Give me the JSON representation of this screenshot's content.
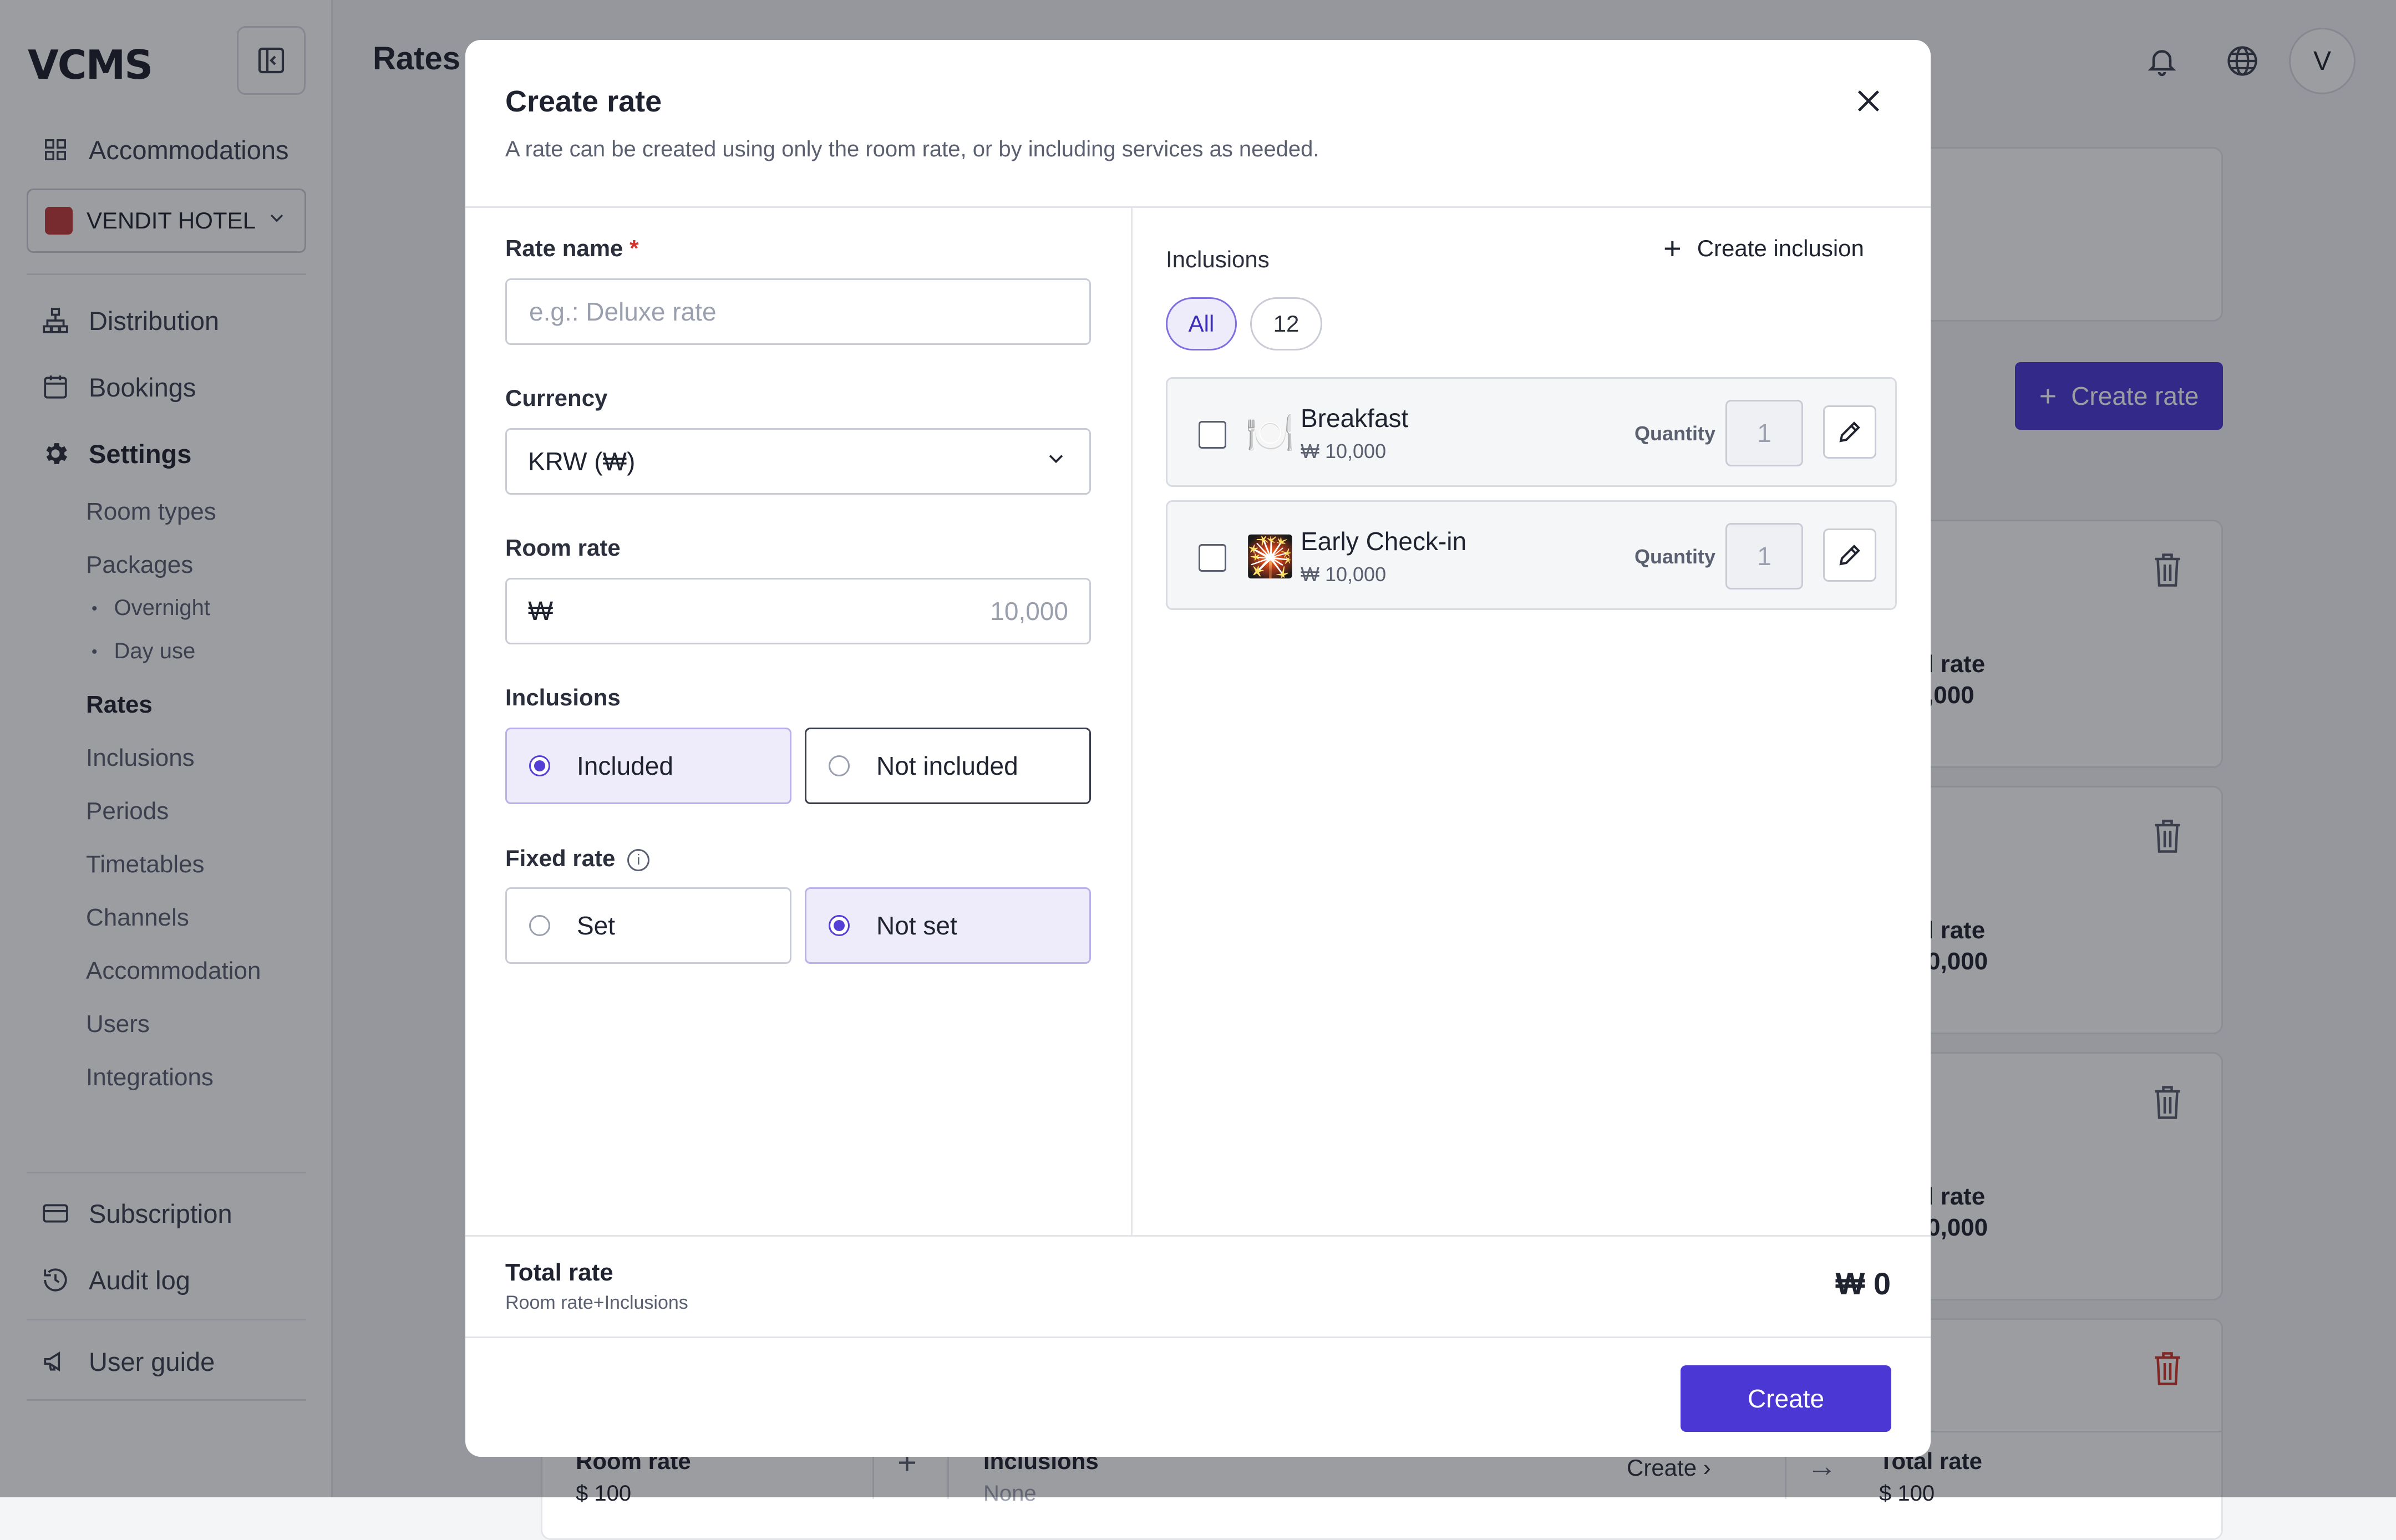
{
  "app": {
    "logo": "VCMS"
  },
  "sidebar": {
    "accommodations": "Accommodations",
    "hotel": "VENDIT HOTEL",
    "distribution": "Distribution",
    "bookings": "Bookings",
    "settings": "Settings",
    "settings_items": [
      "Room types",
      "Packages",
      "Rates",
      "Inclusions",
      "Periods",
      "Timetables",
      "Channels",
      "Accommodation",
      "Users",
      "Integrations"
    ],
    "packages_sub": [
      "Overnight",
      "Day use"
    ],
    "subscription": "Subscription",
    "audit_log": "Audit log",
    "user_guide": "User guide"
  },
  "header": {
    "title": "Rates",
    "avatar": "V"
  },
  "background": {
    "create_rate": "Create rate",
    "totals": [
      {
        "label": "l rate",
        "value": ",000"
      },
      {
        "label": "l rate",
        "value": "0,000"
      },
      {
        "label": "l rate",
        "value": "0,000"
      }
    ],
    "bottom": {
      "room_rate_label": "Room rate",
      "room_rate_value": "$ 100",
      "inclusions_label": "Inclusions",
      "inclusions_value": "None",
      "create_link": "Create",
      "total_label": "Total rate",
      "total_value": "$ 100"
    },
    "colors": {
      "accent": "#4a37d4",
      "danger": "#d0342c"
    }
  },
  "modal": {
    "title": "Create rate",
    "description": "A rate can be created using only the room rate, or by including services as needed.",
    "rate_name": {
      "label": "Rate name",
      "required": "*",
      "placeholder": "e.g.: Deluxe rate",
      "value": ""
    },
    "currency": {
      "label": "Currency",
      "value": "KRW (₩)"
    },
    "room_rate": {
      "label": "Room rate",
      "symbol": "₩",
      "placeholder": "10,000"
    },
    "inclusions_choice": {
      "label": "Inclusions",
      "options": [
        "Included",
        "Not included"
      ],
      "selected": "Included"
    },
    "fixed_rate": {
      "label": "Fixed rate",
      "options": [
        "Set",
        "Not set"
      ],
      "selected": "Not set"
    },
    "right": {
      "label": "Inclusions",
      "create_inclusion": "Create inclusion",
      "filters": [
        "All",
        "12"
      ],
      "items": [
        {
          "icon": "🍽️",
          "icon_name": "breakfast-icon",
          "name": "Breakfast",
          "price": "₩ 10,000",
          "quantity_label": "Quantity",
          "quantity": "1"
        },
        {
          "icon": "🎇",
          "icon_name": "early-checkin-icon",
          "name": "Early Check-in",
          "price": "₩ 10,000",
          "quantity_label": "Quantity",
          "quantity": "1"
        }
      ]
    },
    "total": {
      "label": "Total rate",
      "sub": "Room rate+Inclusions",
      "value": "₩ 0"
    },
    "create_button": "Create"
  }
}
